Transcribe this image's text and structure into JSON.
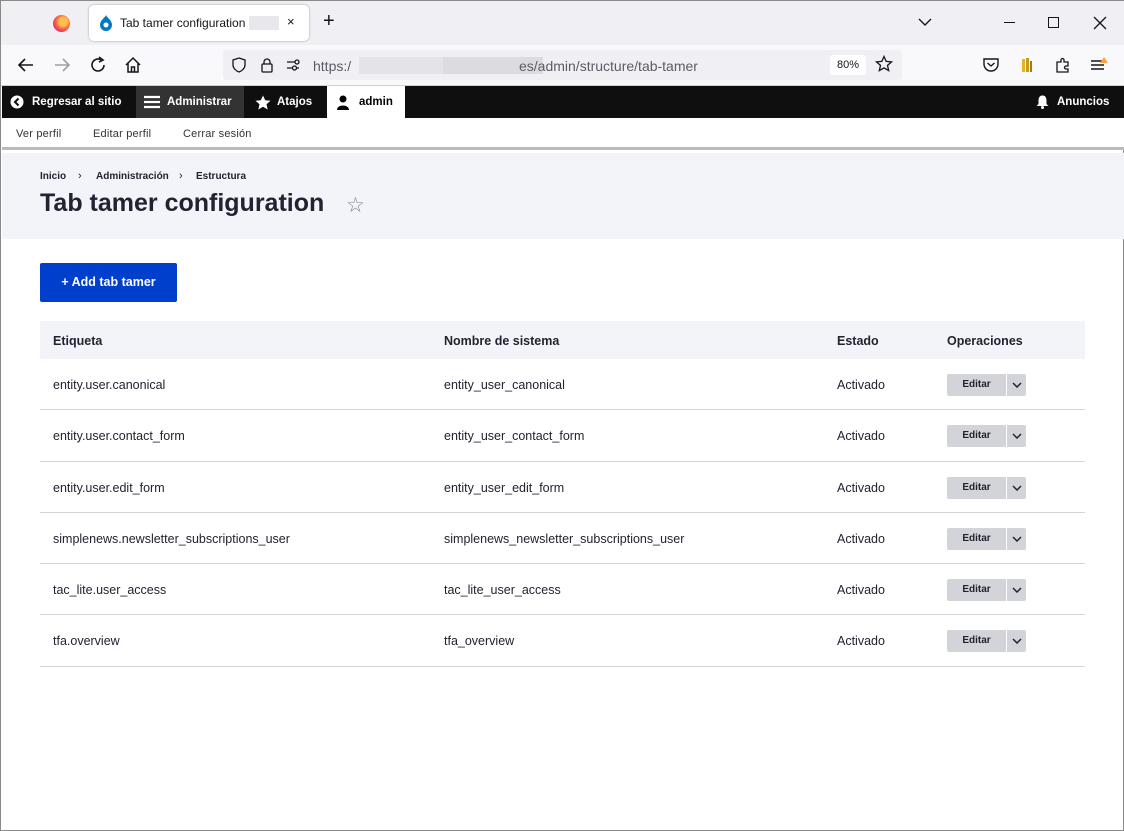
{
  "browser": {
    "tab_title": "Tab tamer configuration |",
    "url_prefix": "https:/",
    "url_path": "es/admin/structure/tab-tamer",
    "zoom": "80%",
    "close_glyph": "×",
    "newtab_glyph": "+"
  },
  "toolbar": {
    "back_label": "Regresar al sitio",
    "manage_label": "Administrar",
    "shortcuts_label": "Atajos",
    "user_label": "admin",
    "announcements_label": "Anuncios"
  },
  "tray": {
    "links": [
      "Ver perfil",
      "Editar perfil",
      "Cerrar sesión"
    ]
  },
  "breadcrumb": [
    "Inicio",
    "Administración",
    "Estructura"
  ],
  "breadcrumb_sep": "›",
  "page": {
    "title": "Tab tamer configuration",
    "star_glyph": "☆",
    "add_button": "+ Add tab tamer"
  },
  "table": {
    "headers": [
      "Etiqueta",
      "Nombre de sistema",
      "Estado",
      "Operaciones"
    ],
    "rows": [
      {
        "label": "entity.user.canonical",
        "machine": "entity_user_canonical",
        "status": "Activado",
        "op": "Editar"
      },
      {
        "label": "entity.user.contact_form",
        "machine": "entity_user_contact_form",
        "status": "Activado",
        "op": "Editar"
      },
      {
        "label": "entity.user.edit_form",
        "machine": "entity_user_edit_form",
        "status": "Activado",
        "op": "Editar"
      },
      {
        "label": "simplenews.newsletter_subscriptions_user",
        "machine": "simplenews_newsletter_subscriptions_user",
        "status": "Activado",
        "op": "Editar"
      },
      {
        "label": "tac_lite.user_access",
        "machine": "tac_lite_user_access",
        "status": "Activado",
        "op": "Editar"
      },
      {
        "label": "tfa.overview",
        "machine": "tfa_overview",
        "status": "Activado",
        "op": "Editar"
      }
    ]
  },
  "colors": {
    "accent": "#003ecc",
    "toolbar_bg": "#0f0f0f",
    "header_bg": "#f3f4f9"
  }
}
